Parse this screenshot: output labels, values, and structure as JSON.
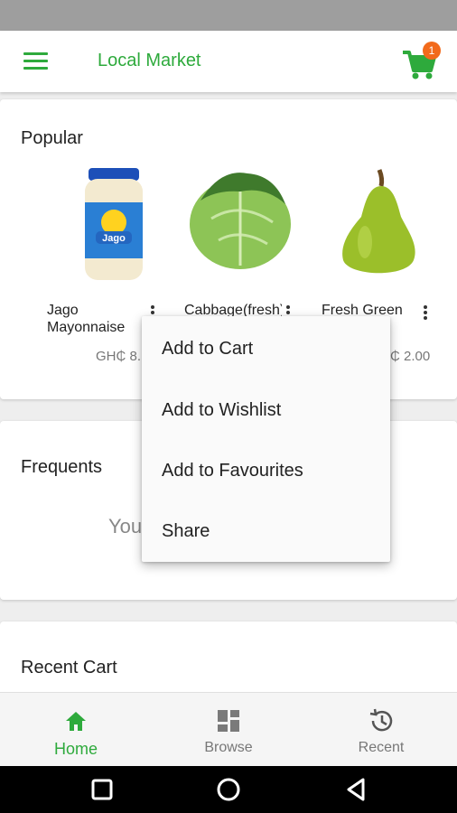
{
  "colors": {
    "accent": "#2eaa3c",
    "badge": "#f26a1b",
    "statusbar": "#9e9e9e"
  },
  "header": {
    "title": "Local Market",
    "cart_count": "1",
    "menu_icon": "hamburger-icon",
    "cart_icon": "shopping-cart-icon"
  },
  "popular": {
    "title": "Popular",
    "products": [
      {
        "name": "Jago Mayonnaise",
        "price": "GH₵ 8.",
        "image": "mayonnaise-jar"
      },
      {
        "name": "Cabbage(fresh)",
        "price": "",
        "image": "cabbage"
      },
      {
        "name": "Fresh Green Pear",
        "price": "₵ 2.00",
        "image": "pear"
      }
    ]
  },
  "frequents": {
    "title": "Frequents",
    "message": "You"
  },
  "recent": {
    "title": "Recent Cart"
  },
  "context_menu": {
    "items": [
      "Add to Cart",
      "Add to Wishlist",
      "Add to Favourites",
      "Share"
    ]
  },
  "bottom_nav": {
    "items": [
      {
        "label": "Home",
        "icon": "home-icon",
        "active": true
      },
      {
        "label": "Browse",
        "icon": "grid-icon",
        "active": false
      },
      {
        "label": "Recent",
        "icon": "history-icon",
        "active": false
      }
    ]
  },
  "system_nav": {
    "icons": [
      "recents-square-icon",
      "home-circle-icon",
      "back-triangle-icon"
    ]
  }
}
